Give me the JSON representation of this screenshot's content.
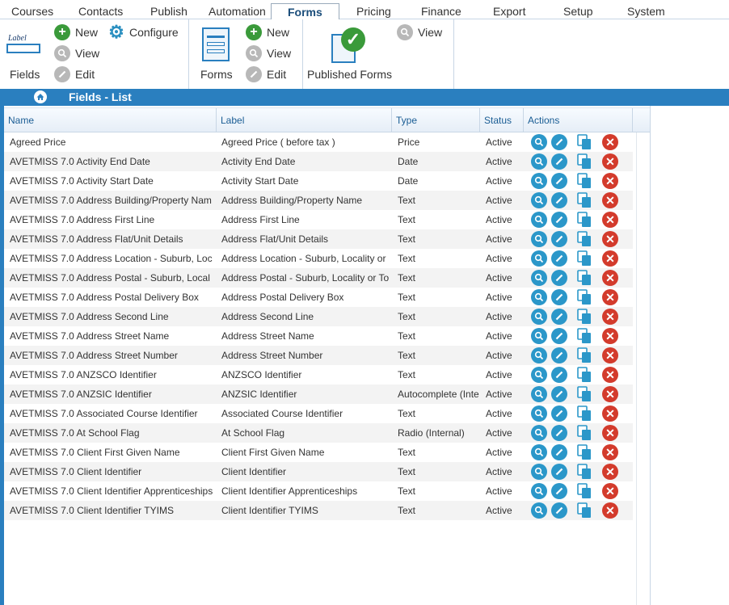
{
  "nav": {
    "tabs": [
      "Courses",
      "Contacts",
      "Publish",
      "Automation",
      "Forms",
      "Pricing",
      "Finance",
      "Export",
      "Setup",
      "System"
    ],
    "active": "Forms"
  },
  "ribbon": {
    "fields": {
      "icon_text": "Label",
      "label": "Fields",
      "new": "New",
      "configure": "Configure",
      "view": "View",
      "edit": "Edit"
    },
    "forms": {
      "label": "Forms",
      "new": "New",
      "view": "View",
      "edit": "Edit"
    },
    "published": {
      "label": "Published Forms",
      "view": "View"
    }
  },
  "page": {
    "title": "Fields - List"
  },
  "grid": {
    "columns": {
      "name": "Name",
      "label": "Label",
      "type": "Type",
      "status": "Status",
      "actions": "Actions"
    },
    "rows": [
      {
        "name": "Agreed Price",
        "label": "Agreed Price ( before tax )",
        "type": "Price",
        "status": "Active"
      },
      {
        "name": "AVETMISS 7.0 Activity End Date",
        "label": "Activity End Date",
        "type": "Date",
        "status": "Active"
      },
      {
        "name": "AVETMISS 7.0 Activity Start Date",
        "label": "Activity Start Date",
        "type": "Date",
        "status": "Active"
      },
      {
        "name": "AVETMISS 7.0 Address Building/Property Nam",
        "label": "Address Building/Property Name",
        "type": "Text",
        "status": "Active"
      },
      {
        "name": "AVETMISS 7.0 Address First Line",
        "label": "Address First Line",
        "type": "Text",
        "status": "Active"
      },
      {
        "name": "AVETMISS 7.0 Address Flat/Unit Details",
        "label": "Address Flat/Unit Details",
        "type": "Text",
        "status": "Active"
      },
      {
        "name": "AVETMISS 7.0 Address Location - Suburb, Loc",
        "label": "Address Location - Suburb, Locality or",
        "type": "Text",
        "status": "Active"
      },
      {
        "name": "AVETMISS 7.0 Address Postal - Suburb, Local",
        "label": "Address Postal - Suburb, Locality or To",
        "type": "Text",
        "status": "Active"
      },
      {
        "name": "AVETMISS 7.0 Address Postal Delivery Box",
        "label": "Address Postal Delivery Box",
        "type": "Text",
        "status": "Active"
      },
      {
        "name": "AVETMISS 7.0 Address Second Line",
        "label": "Address Second Line",
        "type": "Text",
        "status": "Active"
      },
      {
        "name": "AVETMISS 7.0 Address Street Name",
        "label": "Address Street Name",
        "type": "Text",
        "status": "Active"
      },
      {
        "name": "AVETMISS 7.0 Address Street Number",
        "label": "Address Street Number",
        "type": "Text",
        "status": "Active"
      },
      {
        "name": "AVETMISS 7.0 ANZSCO Identifier",
        "label": "ANZSCO Identifier",
        "type": "Text",
        "status": "Active"
      },
      {
        "name": "AVETMISS 7.0 ANZSIC Identifier",
        "label": "ANZSIC Identifier",
        "type": "Autocomplete (Inte",
        "status": "Active"
      },
      {
        "name": "AVETMISS 7.0 Associated Course Identifier",
        "label": "Associated Course Identifier",
        "type": "Text",
        "status": "Active"
      },
      {
        "name": "AVETMISS 7.0 At School Flag",
        "label": "At School Flag",
        "type": "Radio (Internal)",
        "status": "Active"
      },
      {
        "name": "AVETMISS 7.0 Client First Given Name",
        "label": "Client First Given Name",
        "type": "Text",
        "status": "Active"
      },
      {
        "name": "AVETMISS 7.0 Client Identifier",
        "label": "Client Identifier",
        "type": "Text",
        "status": "Active"
      },
      {
        "name": "AVETMISS 7.0 Client Identifier Apprenticeships",
        "label": "Client Identifier Apprenticeships",
        "type": "Text",
        "status": "Active"
      },
      {
        "name": "AVETMISS 7.0 Client Identifier TYIMS",
        "label": "Client Identifier TYIMS",
        "type": "Text",
        "status": "Active"
      }
    ]
  },
  "colors": {
    "accent": "#2a7fbf",
    "delete": "#d33b2c",
    "add": "#3a9a3a"
  }
}
